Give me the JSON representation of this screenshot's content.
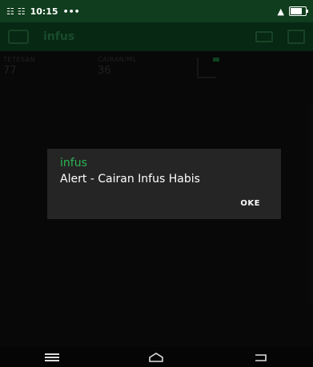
{
  "status": {
    "time_text": "10:15",
    "left_glyphs": "☷ ☷",
    "extra": "•••",
    "signal": "▲"
  },
  "app": {
    "title": "infus"
  },
  "widgets": [
    {
      "label": "TETESAN",
      "value": "77"
    },
    {
      "label": "CAIRAN/ML",
      "value": "36"
    }
  ],
  "dialog": {
    "title": "infus",
    "message": "Alert - Cairan Infus Habis",
    "button": "OKE"
  },
  "colors": {
    "accent": "#2bb453",
    "app_bar": "#0d4a24",
    "status_bar": "#0f3d1d",
    "dialog_bg": "#252525"
  },
  "icons": {
    "back": "back-icon",
    "battery": "battery-icon",
    "nav_menu": "menu-icon",
    "nav_home": "home-icon",
    "nav_back": "return-icon"
  }
}
